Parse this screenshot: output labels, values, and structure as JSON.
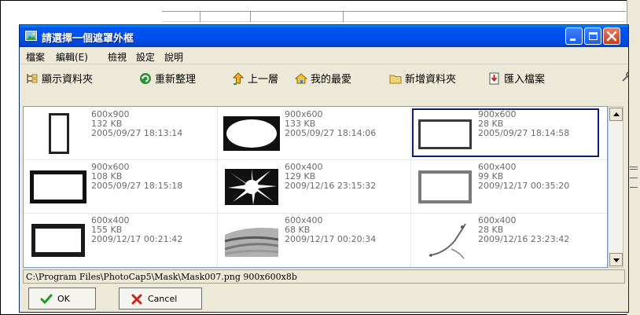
{
  "window": {
    "title": "請選擇一個遮罩外框"
  },
  "menu": [
    "檔案",
    "編輯(E)",
    "檢視",
    "設定",
    "說明"
  ],
  "toolbar": [
    {
      "label": "顯示資料夾",
      "icon": "show-folder-icon"
    },
    {
      "label": "重新整理",
      "icon": "refresh-icon"
    },
    {
      "label": "上一層",
      "icon": "up-level-icon"
    },
    {
      "label": "我的最愛",
      "icon": "favorites-icon"
    },
    {
      "label": "新增資料夾",
      "icon": "new-folder-icon"
    },
    {
      "label": "匯入檔案",
      "icon": "import-file-icon"
    }
  ],
  "thumbnails": [
    {
      "dims": "600x900",
      "size": "132 KB",
      "date": "2005/09/27 18:13:14",
      "style": "portrait-frame"
    },
    {
      "dims": "900x600",
      "size": "133 KB",
      "date": "2005/09/27 18:14:06",
      "style": "oval"
    },
    {
      "dims": "900x600",
      "size": "28 KB",
      "date": "2005/09/27 18:14:58",
      "style": "rough-edge",
      "selected": true
    },
    {
      "dims": "900x600",
      "size": "108 KB",
      "date": "2005/09/27 18:15:18",
      "style": "grunge"
    },
    {
      "dims": "600x400",
      "size": "129 KB",
      "date": "2009/12/16 23:15:32",
      "style": "burst"
    },
    {
      "dims": "600x400",
      "size": "99 KB",
      "date": "2009/12/17 00:35:20",
      "style": "soft-grunge"
    },
    {
      "dims": "600x400",
      "size": "155 KB",
      "date": "2009/12/17 00:21:42",
      "style": "grunge-thick"
    },
    {
      "dims": "600x400",
      "size": "68 KB",
      "date": "2009/12/17 00:20:34",
      "style": "wave"
    },
    {
      "dims": "600x400",
      "size": "28 KB",
      "date": "2009/12/16 23:23:42",
      "style": "swirl"
    }
  ],
  "status": {
    "path": "C:\\Program Files\\PhotoCap5\\Mask\\Mask007.png   900x600x8b"
  },
  "buttons": {
    "ok": "OK",
    "cancel": "Cancel"
  },
  "colors": {
    "title_bar": "#0053ee",
    "selection": "#0a1f7a",
    "close_button": "#d7522f"
  }
}
